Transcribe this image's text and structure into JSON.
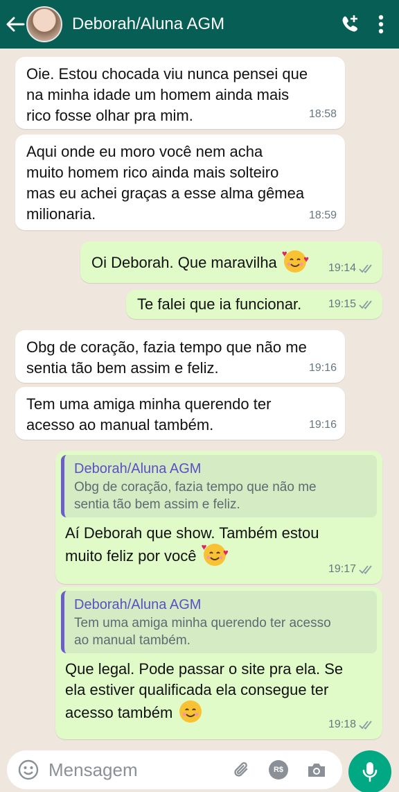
{
  "header": {
    "contact_name": "Deborah/Aluna AGM",
    "icons": [
      "back-arrow-icon",
      "avatar",
      "add-call-icon",
      "more-vert-icon"
    ]
  },
  "messages": [
    {
      "direction": "in",
      "text": "Oie. Estou chocada viu nunca pensei que\nna minha idade um homem ainda mais\nrico fosse olhar pra mim.",
      "time": "18:58"
    },
    {
      "direction": "in",
      "text": "Aqui onde eu moro você nem acha\nmuito homem rico ainda mais solteiro\nmas eu achei graças a esse alma gêmea\nmilionaria.",
      "time": "18:59"
    },
    {
      "direction": "out",
      "text": "Oi Deborah. Que maravilha",
      "emoji": "smiling-face-with-hearts",
      "time": "19:14",
      "status": "read"
    },
    {
      "direction": "out",
      "text": "Te falei que ia funcionar.",
      "time": "19:15",
      "status": "read"
    },
    {
      "direction": "in",
      "text": "Obg de coração, fazia tempo que não me\nsentia tão bem assim e feliz.",
      "time": "19:16"
    },
    {
      "direction": "in",
      "text": "Tem uma amiga minha querendo ter\nacesso ao manual também.",
      "time": "19:16"
    },
    {
      "direction": "out",
      "quote": {
        "name": "Deborah/Aluna AGM",
        "text": "Obg de coração, fazia tempo que não me\nsentia tão bem assim e feliz."
      },
      "text": "Aí Deborah que show. Também estou\nmuito feliz por você",
      "emoji": "smiling-face-with-hearts",
      "time": "19:17",
      "status": "read"
    },
    {
      "direction": "out",
      "quote": {
        "name": "Deborah/Aluna AGM",
        "text": "Tem uma amiga minha querendo ter acesso\nao manual também."
      },
      "text": "Que legal. Pode passar o site pra ela. Se\nela estiver qualificada ela consegue ter\nacesso também",
      "emoji": "smiling-face",
      "time": "19:18",
      "status": "read"
    }
  ],
  "composer": {
    "placeholder": "Mensagem",
    "icons": [
      "emoji-icon",
      "attach-icon",
      "payment-icon",
      "camera-icon",
      "mic-icon"
    ],
    "payment_label": "R$"
  },
  "colors": {
    "header": "#075e54",
    "background": "#efe7de",
    "incoming_bubble": "#ffffff",
    "outgoing_bubble": "#e1fbc8",
    "accent": "#00a884",
    "quote_name": "#5b4fc4"
  }
}
